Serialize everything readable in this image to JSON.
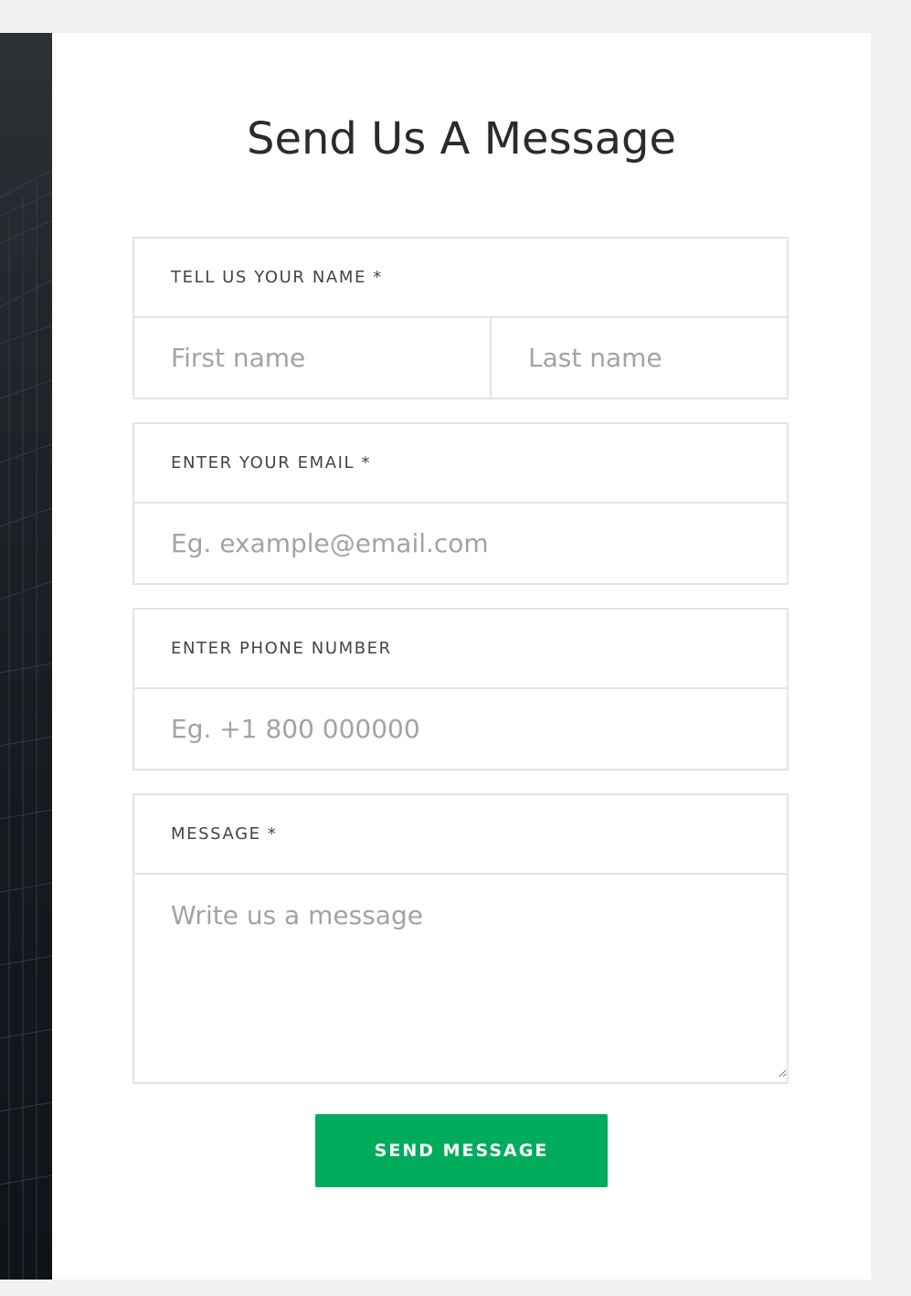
{
  "form": {
    "title": "Send Us A Message",
    "name_label": "TELL US YOUR NAME *",
    "first_name_placeholder": "First name",
    "last_name_placeholder": "Last name",
    "email_label": "ENTER YOUR EMAIL *",
    "email_placeholder": "Eg. example@email.com",
    "phone_label": "ENTER PHONE NUMBER",
    "phone_placeholder": "Eg. +1 800 000000",
    "message_label": "MESSAGE *",
    "message_placeholder": "Write us a message",
    "submit_label": "SEND MESSAGE"
  },
  "colors": {
    "accent": "#00ac5c",
    "background": "#f1f1f1",
    "card": "#ffffff"
  }
}
